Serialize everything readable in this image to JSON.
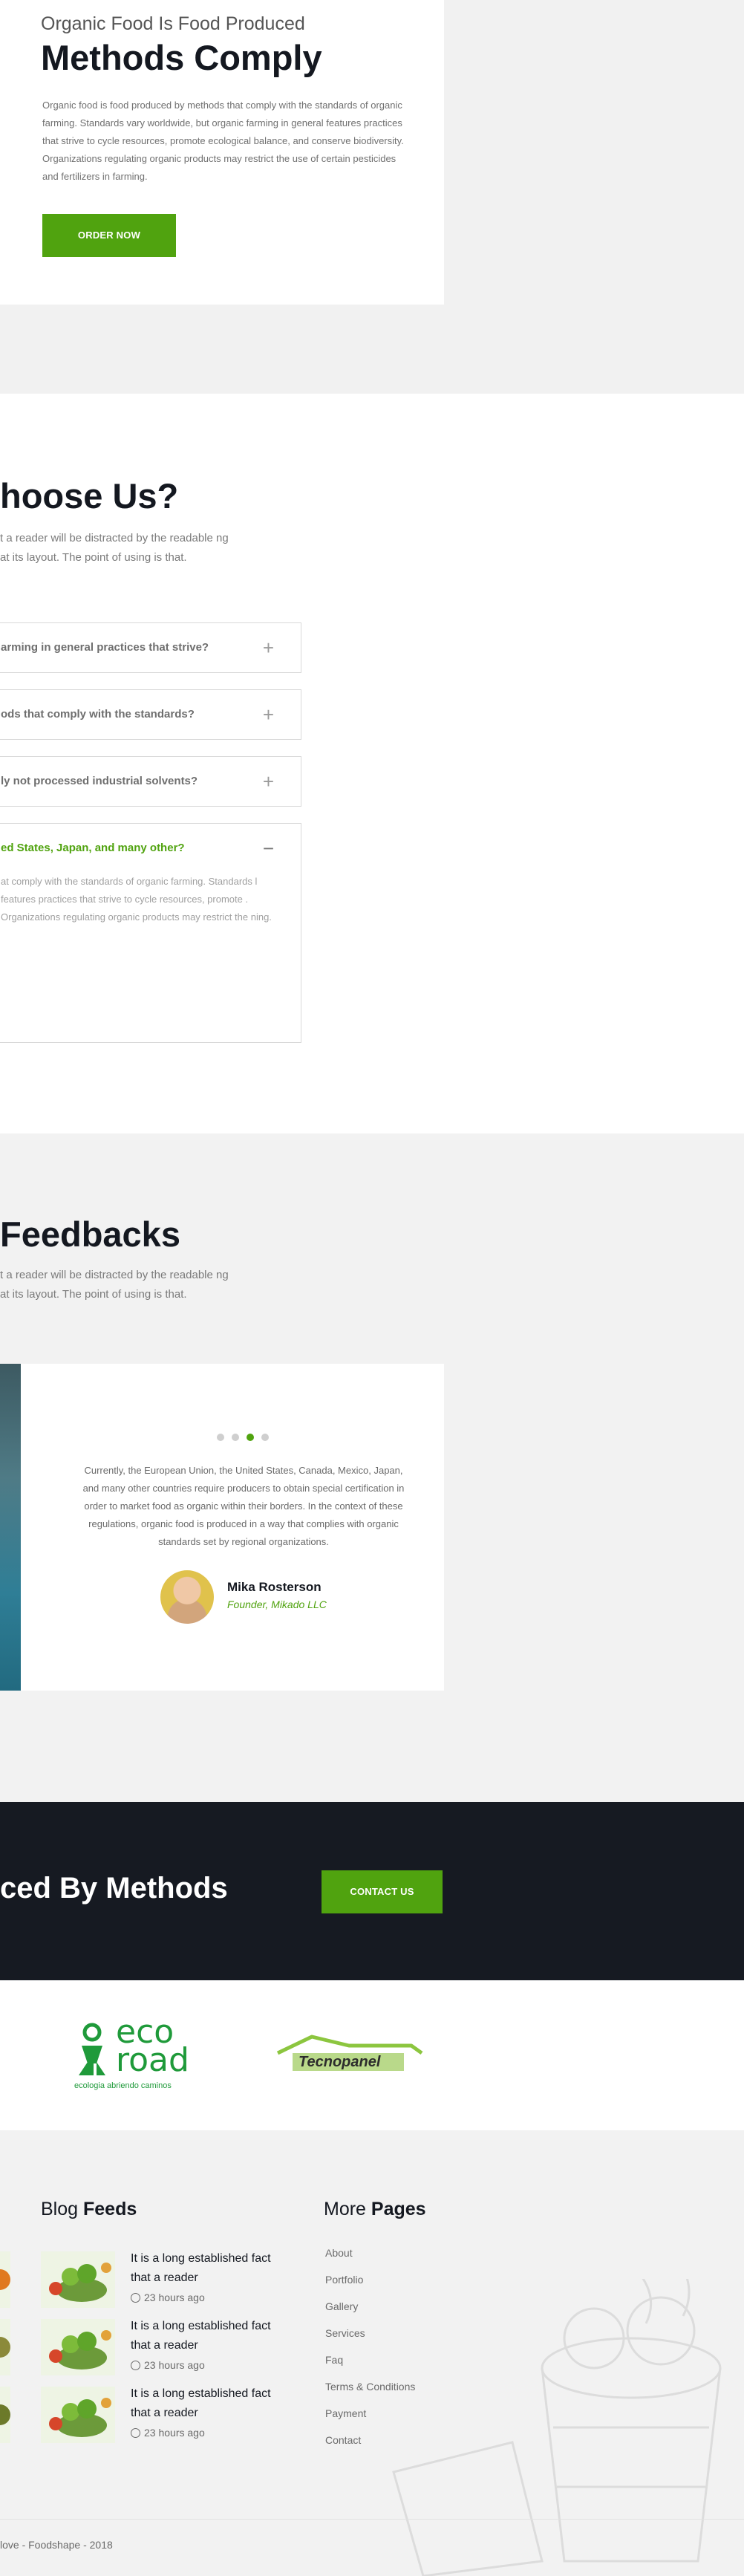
{
  "intro": {
    "subtitle": "Organic Food Is Food Produced",
    "title": "Methods Comply",
    "paragraph": "Organic food is food produced by methods that comply with the standards of organic farming. Standards vary worldwide, but organic farming in general features practices that strive to cycle resources, promote ecological balance, and conserve biodiversity. Organizations regulating organic products may restrict the use of certain pesticides and fertilizers in farming.",
    "button": "ORDER NOW"
  },
  "why": {
    "title": "hoose Us?",
    "subtitle": "t a reader will be distracted by the readable ng at its layout. The point of using is that.",
    "items": [
      {
        "question": "arming in general practices that strive?",
        "icon": "plus-icon",
        "symbol": "+"
      },
      {
        "question": "ods that comply with the standards?",
        "icon": "plus-icon",
        "symbol": "+"
      },
      {
        "question": "ly not processed industrial solvents?",
        "icon": "plus-icon",
        "symbol": "+"
      },
      {
        "question": "ed States, Japan, and many other?",
        "icon": "minus-icon",
        "symbol": "−",
        "answer": "at comply with the standards of organic farming. Standards l features practices that strive to cycle resources, promote . Organizations regulating organic products may restrict the ning."
      }
    ]
  },
  "feedbacks": {
    "title": "Feedbacks",
    "subtitle": "t a reader will be distracted by the readable ng at its layout. The point of using is that.",
    "quote": "Currently, the European Union, the United States, Canada, Mexico, Japan, and many other countries require producers to obtain special certification in order to market food as organic within their borders. In the context of these regulations, organic food is produced in a way that complies with organic standards set by regional organizations.",
    "name": "Mika Rosterson",
    "role": "Founder, Mikado LLC",
    "dots": 4,
    "active_dot": 3
  },
  "cta": {
    "title": "ced By Methods",
    "button": "CONTACT US"
  },
  "partners": {
    "eco": {
      "line1": "eco",
      "line2": "road",
      "tagline": "ecologia abriendo caminos"
    },
    "tecno": {
      "name": "Tecnopanel"
    }
  },
  "footer": {
    "blog": {
      "title_light": "Blog",
      "title_bold": "Feeds"
    },
    "posts": [
      {
        "title": "It is a long established fact that a reader",
        "time": "23 hours ago"
      },
      {
        "title": "It is a long established fact that a reader",
        "time": "23 hours ago"
      },
      {
        "title": "It is a long established fact that a reader",
        "time": "23 hours ago"
      }
    ],
    "more": {
      "title_light": "More",
      "title_bold": "Pages"
    },
    "links": [
      "About",
      "Portfolio",
      "Gallery",
      "Services",
      "Faq",
      "Terms & Conditions",
      "Payment",
      "Contact"
    ],
    "copyright": "love - Foodshape - 2018"
  },
  "colors": {
    "accent": "#50a30f",
    "dark": "#161a22"
  }
}
